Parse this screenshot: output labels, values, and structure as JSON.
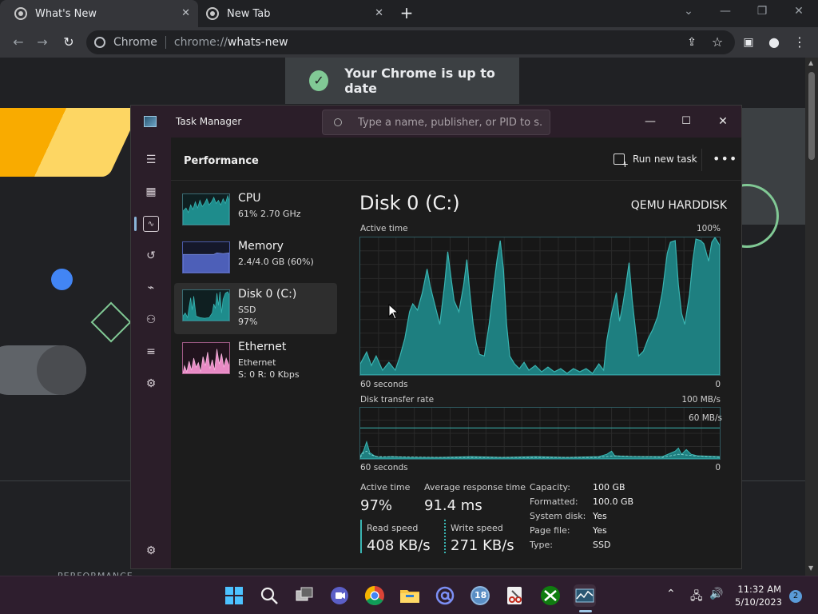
{
  "browser": {
    "tabs": [
      {
        "title": "What's New",
        "active": true
      },
      {
        "title": "New Tab",
        "active": false
      }
    ],
    "omnibox": {
      "site": "Chrome",
      "url_scheme": "chrome://",
      "url_path": "whats-new"
    }
  },
  "page": {
    "banner_text": "Your Chrome is up to date",
    "footer_partial": "PERFORMANCE"
  },
  "task_manager": {
    "title": "Task Manager",
    "search_placeholder": "Type a name, publisher, or PID to s...",
    "section_title": "Performance",
    "run_new_task": "Run new task",
    "resources": [
      {
        "name": "CPU",
        "sub1": "61% 2.70 GHz",
        "sub2": ""
      },
      {
        "name": "Memory",
        "sub1": "2.4/4.0 GB (60%)",
        "sub2": ""
      },
      {
        "name": "Disk 0 (C:)",
        "sub1": "SSD",
        "sub2": "97%"
      },
      {
        "name": "Ethernet",
        "sub1": "Ethernet",
        "sub2": "S: 0 R: 0 Kbps"
      }
    ],
    "detail": {
      "title": "Disk 0 (C:)",
      "model": "QEMU HARDDISK",
      "active_time_label": "Active time",
      "active_time_max": "100%",
      "time_span": "60 seconds",
      "zero": "0",
      "transfer_label": "Disk transfer rate",
      "transfer_max": "100 MB/s",
      "transfer_mid": "60 MB/s",
      "stats": {
        "active_time_label": "Active time",
        "active_time": "97%",
        "resp_label": "Average response time",
        "resp": "91.4 ms",
        "read_label": "Read speed",
        "read": "408 KB/s",
        "write_label": "Write speed",
        "write": "271 KB/s"
      },
      "props": [
        {
          "k": "Capacity:",
          "v": "100 GB"
        },
        {
          "k": "Formatted:",
          "v": "100.0 GB"
        },
        {
          "k": "System disk:",
          "v": "Yes"
        },
        {
          "k": "Page file:",
          "v": "Yes"
        },
        {
          "k": "Type:",
          "v": "SSD"
        }
      ]
    }
  },
  "taskbar": {
    "time": "11:32 AM",
    "date": "5/10/2023",
    "notifications": "2",
    "calendar_badge": "18"
  },
  "colors": {
    "chart_fill": "#1e8c8c",
    "chart_line": "#39b3b0",
    "accent_green": "#81c995",
    "google_blue": "#4285f4"
  }
}
